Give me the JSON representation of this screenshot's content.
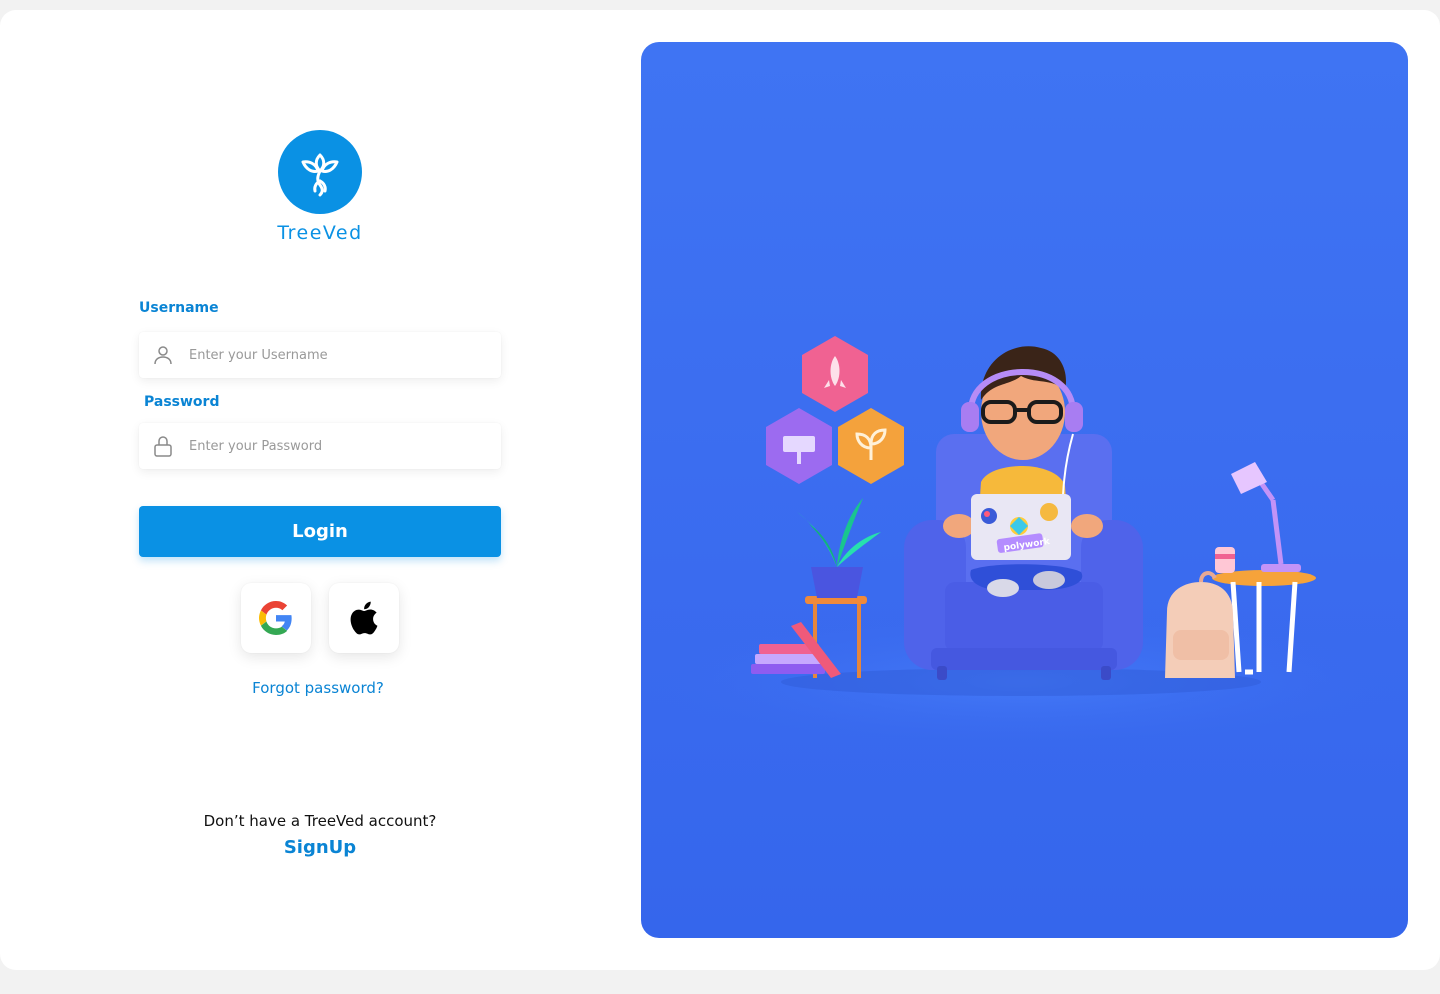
{
  "brand": {
    "name": "TreeVed",
    "color": "#0a91e4",
    "logo_icon": "sprout-icon"
  },
  "form": {
    "username": {
      "label": "Username",
      "placeholder": "Enter your Username",
      "icon": "user-icon"
    },
    "password": {
      "label": "Password",
      "placeholder": "Enter your Password",
      "icon": "lock-icon"
    },
    "login_label": "Login"
  },
  "social": [
    {
      "provider": "google",
      "icon": "google-icon"
    },
    {
      "provider": "apple",
      "icon": "apple-icon"
    }
  ],
  "links": {
    "forgot_password": "Forgot password?",
    "no_account_text": "Don’t have a TreeVed account?",
    "signup": "SignUp"
  },
  "hero": {
    "background": "#3f74f3",
    "illustration": "person-on-armchair-with-laptop",
    "laptop_sticker_text": "polywork"
  }
}
